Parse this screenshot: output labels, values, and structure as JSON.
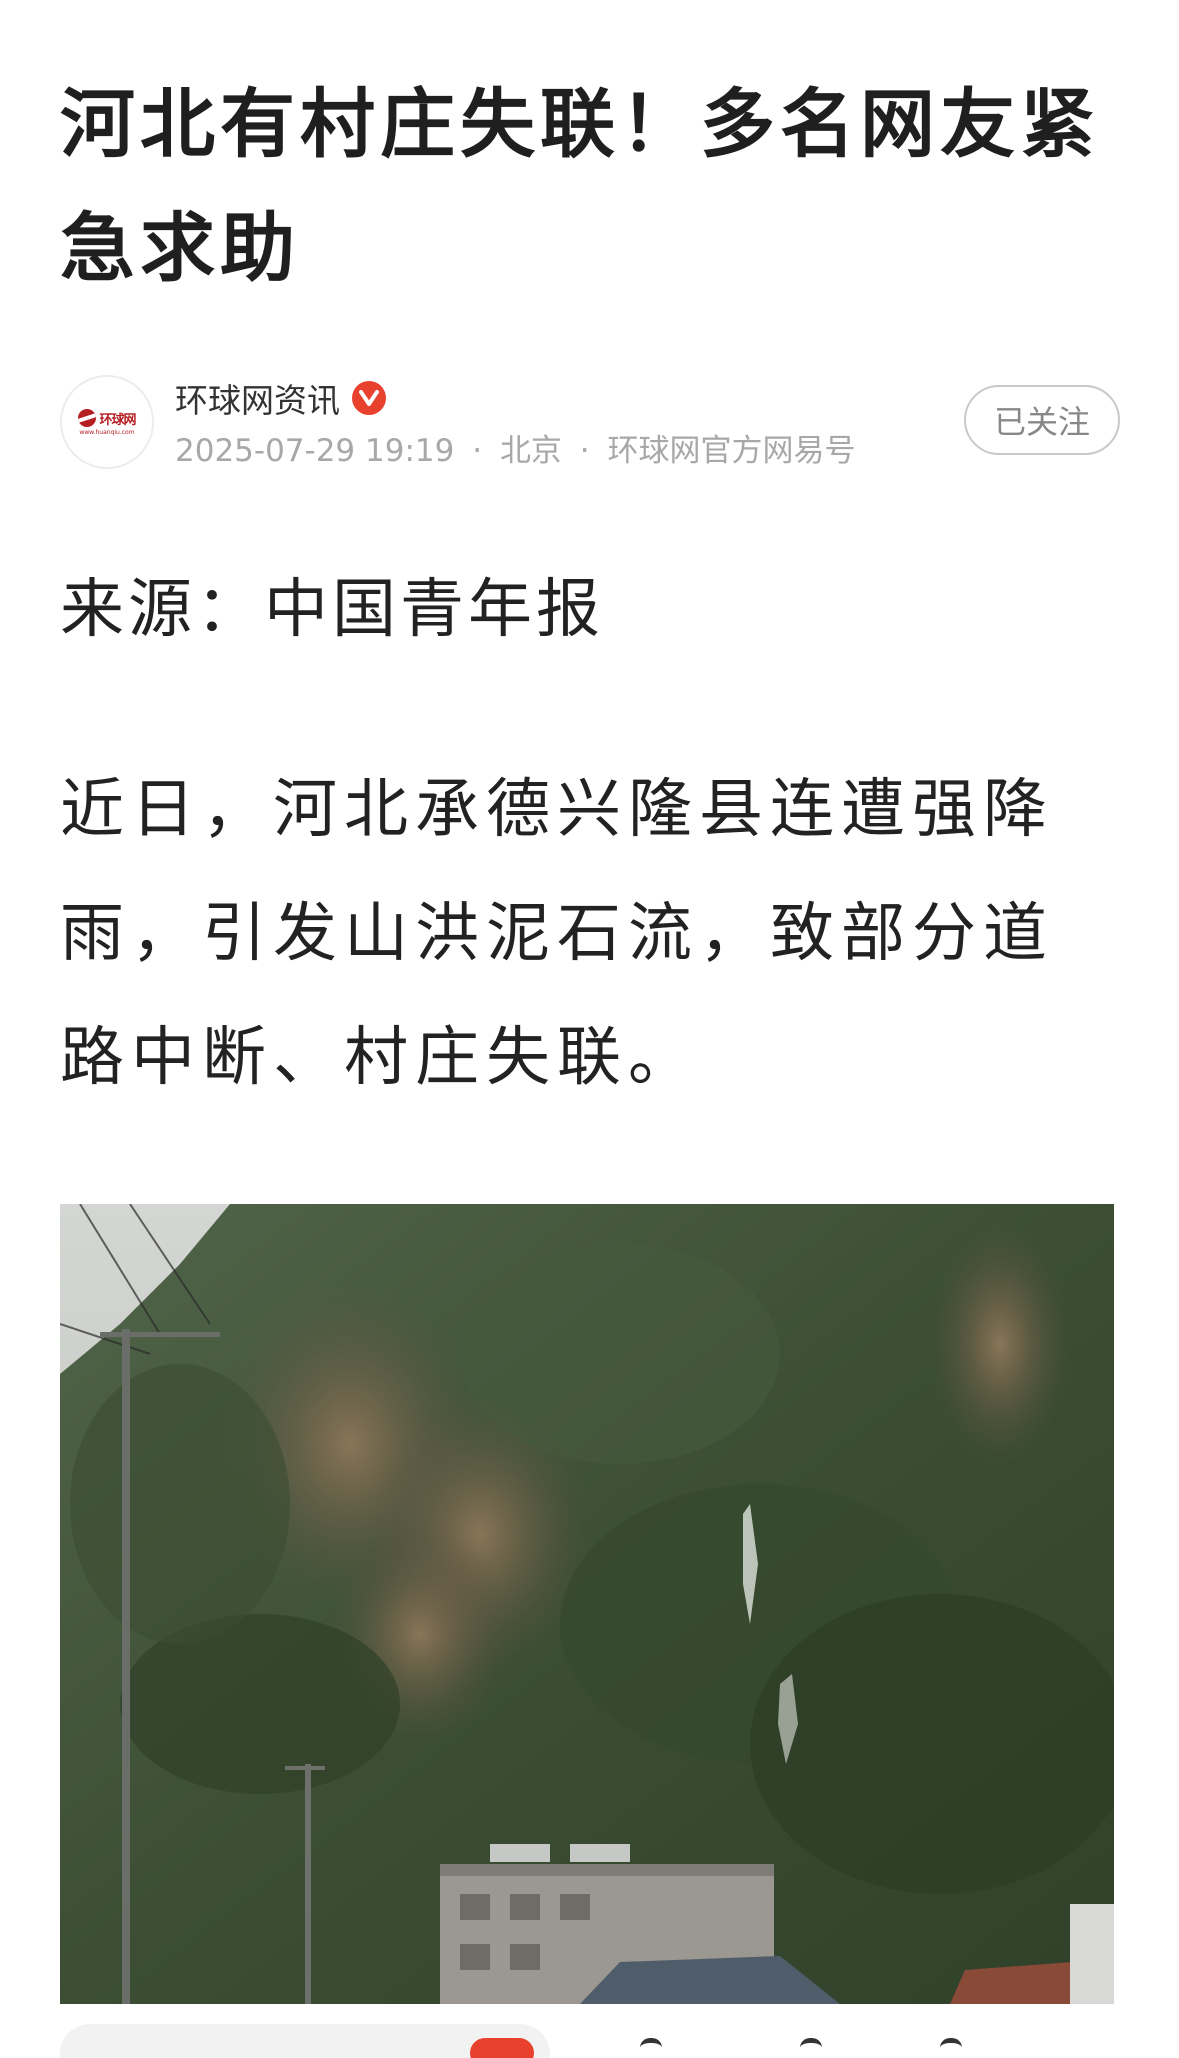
{
  "article": {
    "title": "河北有村庄失联！多名网友紧急求助",
    "source_line": "来源：中国青年报",
    "body": "近日，河北承德兴隆县连遭强降雨，引发山洪泥石流，致部分道路中断、村庄失联。"
  },
  "author": {
    "name": "环球网资讯",
    "avatar_logo_text": "环球网",
    "avatar_logo_url": "www.huanqiu.com",
    "verified_icon": "verified-v-icon",
    "verified_color": "#e8412d",
    "datetime": "2025-07-29 19:19",
    "location": "北京",
    "platform": "环球网官方网易号",
    "separator": "·",
    "follow_label": "已关注"
  },
  "image": {
    "icon": "mountain-landslide-photo",
    "description_colors": {
      "sky": "#c9ccc8",
      "mountain": "#3f5236",
      "rock": "#7a6650",
      "building": "#9a9890"
    }
  },
  "colors": {
    "accent": "#e8412d",
    "logo_red": "#b51e23",
    "meta_gray": "#a8a8a8"
  }
}
